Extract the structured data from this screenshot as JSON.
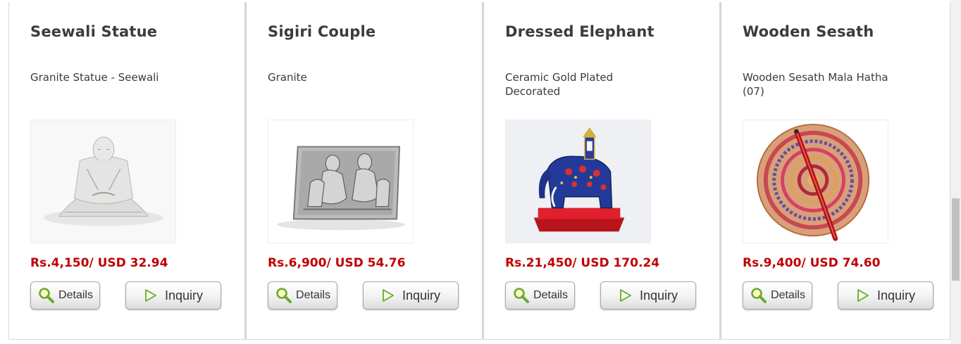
{
  "products": [
    {
      "title": "Seewali Statue",
      "description": "Granite Statue - Seewali",
      "price": "Rs.4,150/ USD 32.94",
      "details_label": "Details",
      "inquiry_label": "Inquiry"
    },
    {
      "title": "Sigiri Couple",
      "description": "Granite",
      "price": "Rs.6,900/ USD 54.76",
      "details_label": "Details",
      "inquiry_label": "Inquiry"
    },
    {
      "title": "Dressed Elephant",
      "description": "Ceramic Gold Plated Decorated",
      "price": "Rs.21,450/ USD 170.24",
      "details_label": "Details",
      "inquiry_label": "Inquiry"
    },
    {
      "title": "Wooden Sesath",
      "description": "Wooden Sesath Mala Hatha (07)",
      "price": "Rs.9,400/ USD 74.60",
      "details_label": "Details",
      "inquiry_label": "Inquiry"
    }
  ],
  "icons": {
    "details": "magnifier-icon",
    "inquiry": "play-arrow-icon"
  },
  "colors": {
    "price": "#c00000",
    "title": "#3c3c3c",
    "icon_green": "#6aaa2a"
  }
}
